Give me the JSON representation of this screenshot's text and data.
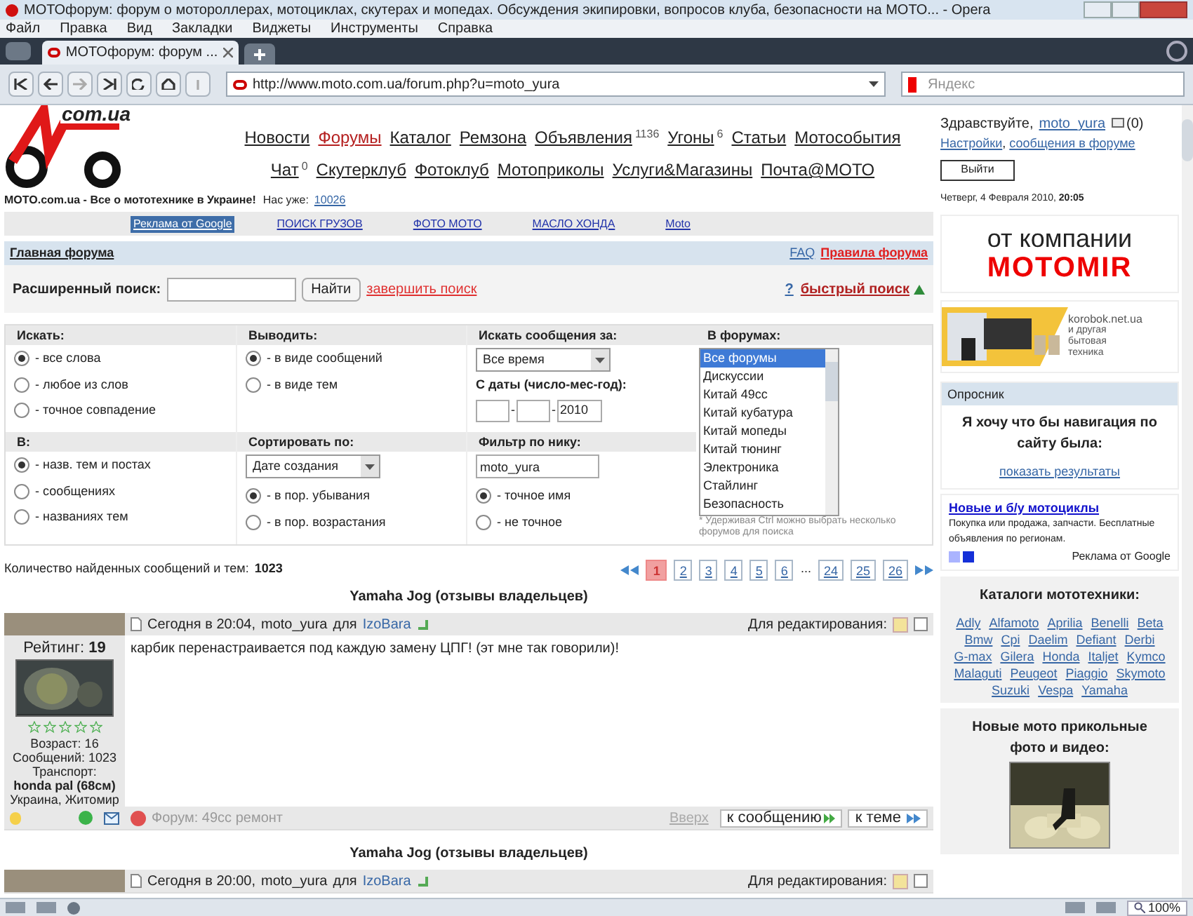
{
  "window": {
    "title": "МОТОфорум: форум о мотороллерах, мотоциклах, скутерах и мопедах. Обсуждения экипировки, вопросов клуба, безопасности на МОТО... - Opera"
  },
  "menu": [
    "Файл",
    "Правка",
    "Вид",
    "Закладки",
    "Виджеты",
    "Инструменты",
    "Справка"
  ],
  "tabs": [
    {
      "label": "МОТОфорум: форум ...",
      "selected": true
    }
  ],
  "address_bar": {
    "url": "http://www.moto.com.ua/forum.php?u=moto_yura"
  },
  "search_bar": {
    "placeholder": "Яндекс"
  },
  "logo": {
    "text": "com.ua"
  },
  "nav_rows": [
    [
      {
        "label": "Новости",
        "selected": false
      },
      {
        "label": "Форумы",
        "selected": true
      },
      {
        "label": "Каталог",
        "selected": false
      },
      {
        "label": "Ремзона",
        "selected": false
      },
      {
        "label": "Объявления",
        "sup": "1136",
        "selected": false
      },
      {
        "label": "Угоны",
        "sup": "6",
        "selected": false
      },
      {
        "label": "Статьи",
        "selected": false
      },
      {
        "label": "Мотособытия",
        "selected": false
      }
    ],
    [
      {
        "label": "Чат",
        "sup": "0",
        "selected": false
      },
      {
        "label": "Скутерклуб",
        "selected": false
      },
      {
        "label": "Фотоклуб",
        "selected": false
      },
      {
        "label": "Мотоприколы",
        "selected": false
      },
      {
        "label": "Услуги&Магазины",
        "selected": false
      },
      {
        "label": "Почта@МОТО",
        "selected": false
      }
    ]
  ],
  "tagline": {
    "text": "MOTO.com.ua - Все о мототехнике в Украине!",
    "users_label": "Нас уже:",
    "users_count": "10026"
  },
  "ad_links": [
    {
      "label": "Реклама от Google",
      "kind": "label"
    },
    {
      "label": "ПОИСК ГРУЗОВ",
      "kind": "link"
    },
    {
      "label": "ФОТО МОТО",
      "kind": "link"
    },
    {
      "label": "МАСЛО ХОНДА",
      "kind": "link"
    },
    {
      "label": "Moto",
      "kind": "link"
    }
  ],
  "breadcrumb": {
    "home": "Главная форума",
    "faq": "FAQ",
    "rules": "Правила форума"
  },
  "search": {
    "label": "Расширенный поиск:",
    "button": "Найти",
    "end_link": "завершить поиск",
    "help": "?",
    "quick_link": "быстрый поиск"
  },
  "options": {
    "search_mode": {
      "title": "Искать:",
      "options": [
        {
          "label": "- все слова",
          "selected": true
        },
        {
          "label": "- любое из слов",
          "selected": false
        },
        {
          "label": "- точное совпадение",
          "selected": false
        }
      ]
    },
    "output": {
      "title": "Выводить:",
      "options": [
        {
          "label": "- в виде сообщений",
          "selected": true
        },
        {
          "label": "- в виде тем",
          "selected": false
        }
      ]
    },
    "period": {
      "title": "Искать сообщения за:",
      "value": "Все время",
      "date_label": "С даты (число-мес-год):",
      "separator": "-",
      "year": "2010"
    },
    "forums": {
      "title": "В форумах:",
      "items": [
        {
          "label": "Все форумы",
          "selected": true
        },
        {
          "label": "Дискуссии",
          "selected": false
        },
        {
          "label": "Китай 49сс",
          "selected": false
        },
        {
          "label": "Китай кубатура",
          "selected": false
        },
        {
          "label": "Китай мопеды",
          "selected": false
        },
        {
          "label": "Китай тюнинг",
          "selected": false
        },
        {
          "label": "Электроника",
          "selected": false
        },
        {
          "label": "Стайлинг",
          "selected": false
        },
        {
          "label": "Безопасность",
          "selected": false
        }
      ],
      "note": "* Удерживая Ctrl можно выбрать несколько форумов для поиска"
    },
    "where": {
      "title": "В:",
      "options": [
        {
          "label": "- назв. тем и постах",
          "selected": true
        },
        {
          "label": "- сообщениях",
          "selected": false
        },
        {
          "label": "- названиях тем",
          "selected": false
        }
      ]
    },
    "sort": {
      "title": "Сортировать по:",
      "value": "Дате создания",
      "options": [
        {
          "label": "- в пор. убывания",
          "selected": true
        },
        {
          "label": "- в пор. возрастания",
          "selected": false
        }
      ]
    },
    "nick": {
      "title": "Фильтр по нику:",
      "value": "moto_yura",
      "options": [
        {
          "label": "- точное имя",
          "selected": true
        },
        {
          "label": "- не точное",
          "selected": false
        }
      ]
    }
  },
  "results": {
    "label": "Количество найденных сообщений и тем:",
    "count": "1023"
  },
  "pages": [
    {
      "label": "1",
      "kind": "page",
      "selected": true
    },
    {
      "label": "2",
      "kind": "page",
      "selected": false
    },
    {
      "label": "3",
      "kind": "page",
      "selected": false
    },
    {
      "label": "4",
      "kind": "page",
      "selected": false
    },
    {
      "label": "5",
      "kind": "page",
      "selected": false
    },
    {
      "label": "6",
      "kind": "page",
      "selected": false
    },
    {
      "label": "...",
      "kind": "gap"
    },
    {
      "label": "24",
      "kind": "page",
      "selected": false
    },
    {
      "label": "25",
      "kind": "page",
      "selected": false
    },
    {
      "label": "26",
      "kind": "page",
      "selected": false
    }
  ],
  "posts": [
    {
      "topic": "Yamaha Jog (отзывы владельцев)",
      "time": "Сегодня в 20:04,",
      "user": "moto_yura",
      "for": "для",
      "to": "IzoBara",
      "edit_label": "Для редактирования:",
      "rating_label": "Рейтинг:",
      "rating": "19",
      "stars": 0,
      "details": [
        "Возраст: 16",
        "Сообщений: 1023",
        "Транспорт:"
      ],
      "vehicle": "honda pal (68см)",
      "location": "Украина, Житомир",
      "body": "карбик перенастраивается под каждую замену ЦПГ! (эт мне так говорили)!",
      "forum": "Форум: 49cc ремонт",
      "top": "Вверх",
      "to_post": "к сообщению",
      "to_topic": "к теме",
      "checked": false,
      "kind": "full"
    },
    {
      "topic": "Yamaha Jog (отзывы владельцев)",
      "time": "Сегодня в 20:00,",
      "user": "moto_yura",
      "for": "для",
      "to": "IzoBara",
      "edit_label": "Для редактирования:",
      "checked": false,
      "kind": "header"
    }
  ],
  "sidebar": {
    "greeting": "Здравствуйте,",
    "user": "moto_yura",
    "mail_count": "(0)",
    "settings": "Настройки",
    "comma": ",",
    "messages": "сообщения в форуме",
    "logout": "Выйти",
    "date": "Четверг, 4 Февраля 2010,",
    "time": "20:05",
    "banner": {
      "line1": "от компании",
      "line2": "MOTOMIR"
    },
    "banner2": {
      "site": "korobok.net.ua",
      "text": "и другая бытовая техника"
    },
    "poll": {
      "title": "Опросник",
      "question": "Я хочу что бы навигация по сайту была:",
      "link": "показать результаты"
    },
    "ad": {
      "title": "Новые и б/у мотоциклы",
      "text": "Покупка или продажа, запчасти. Бесплатные объявления по регионам.",
      "credit": "Реклама от Google"
    },
    "catalog": {
      "title": "Каталоги мототехники:",
      "brands": [
        "Adly",
        "Alfamoto",
        "Aprilia",
        "Benelli",
        "Beta",
        "Bmw",
        "Cpi",
        "Daelim",
        "Defiant",
        "Derbi",
        "G-max",
        "Gilera",
        "Honda",
        "Italjet",
        "Kymco",
        "Malaguti",
        "Peugeot",
        "Piaggio",
        "Skymoto",
        "Suzuki",
        "Vespa",
        "Yamaha"
      ]
    },
    "photos": {
      "title": "Новые мото прикольные фото и видео:"
    }
  },
  "status_bar": {
    "zoom": "100%"
  }
}
